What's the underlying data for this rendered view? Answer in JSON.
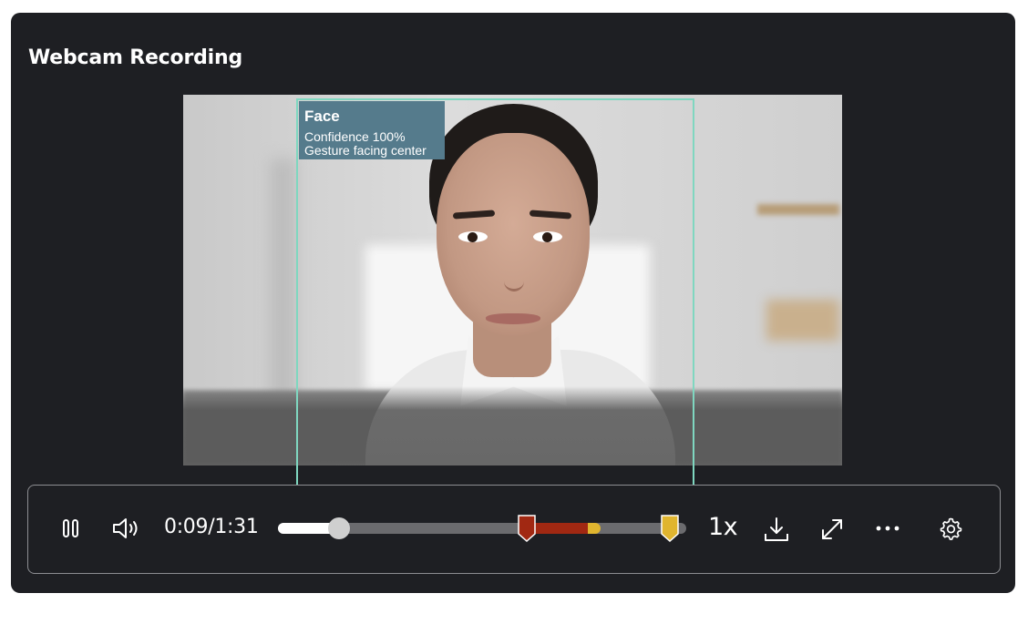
{
  "panel": {
    "title": "Webcam Recording"
  },
  "detection": {
    "label": "Face",
    "confidence": "Confidence 100%",
    "gesture": "Gesture facing center",
    "box_color": "#7fd7c0",
    "label_bg": "#557b8c"
  },
  "player": {
    "play_icon": "pause-icon",
    "volume_icon": "volume-icon",
    "time": "0:09/1:31",
    "progress_fraction": 0.15,
    "events": {
      "red_start_fraction": 0.61,
      "red_end_fraction": 0.76,
      "yellow_end_fraction": 0.79,
      "marker_red_fraction": 0.61,
      "marker_yellow_fraction": 0.96,
      "red_color": "#a12812",
      "yellow_color": "#e0b52f"
    },
    "speed": "1x",
    "download_icon": "download-icon",
    "fullscreen_icon": "expand-icon",
    "more_icon": "more-icon",
    "settings_icon": "gear-icon"
  }
}
